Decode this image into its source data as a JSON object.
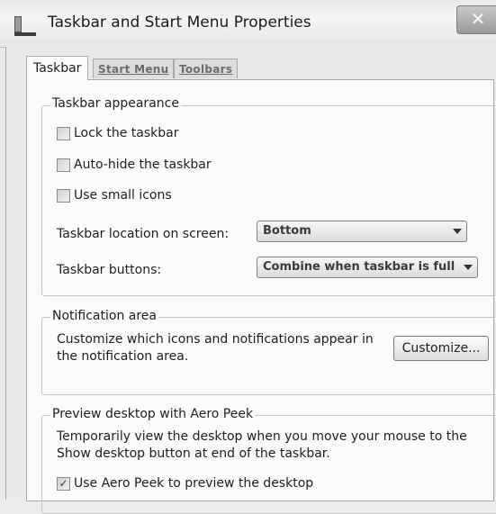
{
  "window": {
    "title": "Taskbar and Start Menu Properties",
    "close_glyph": "✕"
  },
  "tabs": [
    {
      "label": "Taskbar",
      "active": true
    },
    {
      "label": "Start Menu",
      "active": false
    },
    {
      "label": "Toolbars",
      "active": false
    }
  ],
  "appearance": {
    "title": "Taskbar appearance",
    "lock": {
      "label": "Lock the taskbar",
      "checked": false
    },
    "autohide": {
      "label": "Auto-hide the taskbar",
      "checked": false
    },
    "small_icons": {
      "label": "Use small icons",
      "checked": false
    },
    "location_label": "Taskbar location on screen:",
    "location_value": "Bottom",
    "buttons_label": "Taskbar buttons:",
    "buttons_value": "Combine when taskbar is full"
  },
  "notification": {
    "title": "Notification area",
    "text": "Customize which icons and notifications appear in the notification area.",
    "customize_label": "Customize..."
  },
  "aero_peek": {
    "title": "Preview desktop with Aero Peek",
    "text": "Temporarily view the desktop when you move your mouse to the Show desktop button at end of the taskbar.",
    "use_label": "Use Aero Peek to preview the desktop",
    "use_checked": true
  },
  "icons": {
    "window": "taskbar-properties-icon",
    "close": "close-icon",
    "dropdown": "chevron-down-icon",
    "check": "checkmark-icon"
  }
}
